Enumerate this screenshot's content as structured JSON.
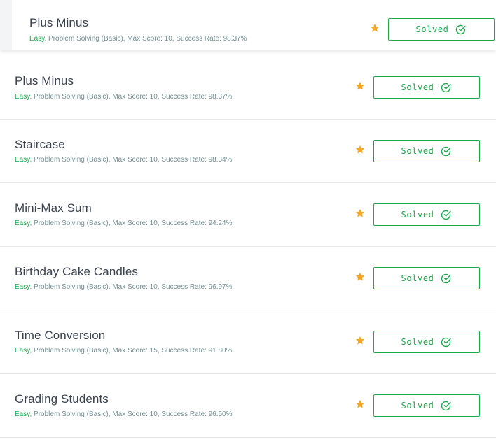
{
  "challenges": [
    {
      "title": "Plus Minus",
      "difficulty": "Easy",
      "details": ", Problem Solving (Basic), Max Score: 10, Success Rate: 98.37%",
      "button_label": "Solved",
      "star_icon": "star-icon",
      "check_icon": "check-circle-icon"
    },
    {
      "title": "Plus Minus",
      "difficulty": "Easy",
      "details": ", Problem Solving (Basic), Max Score: 10, Success Rate: 98.37%",
      "button_label": "Solved",
      "star_icon": "star-icon",
      "check_icon": "check-circle-icon"
    },
    {
      "title": "Staircase",
      "difficulty": "Easy",
      "details": ", Problem Solving (Basic), Max Score: 10, Success Rate: 98.34%",
      "button_label": "Solved",
      "star_icon": "star-icon",
      "check_icon": "check-circle-icon"
    },
    {
      "title": "Mini-Max Sum",
      "difficulty": "Easy",
      "details": ", Problem Solving (Basic), Max Score: 10, Success Rate: 94.24%",
      "button_label": "Solved",
      "star_icon": "star-icon",
      "check_icon": "check-circle-icon"
    },
    {
      "title": "Birthday Cake Candles",
      "difficulty": "Easy",
      "details": ", Problem Solving (Basic), Max Score: 10, Success Rate: 96.97%",
      "button_label": "Solved",
      "star_icon": "star-icon",
      "check_icon": "check-circle-icon"
    },
    {
      "title": "Time Conversion",
      "difficulty": "Easy",
      "details": ", Problem Solving (Basic), Max Score: 15, Success Rate: 91.80%",
      "button_label": "Solved",
      "star_icon": "star-icon",
      "check_icon": "check-circle-icon"
    },
    {
      "title": "Grading Students",
      "difficulty": "Easy",
      "details": ", Problem Solving (Basic), Max Score: 10, Success Rate: 96.50%",
      "button_label": "Solved",
      "star_icon": "star-icon",
      "check_icon": "check-circle-icon"
    }
  ],
  "colors": {
    "accent_green": "#1ba94c",
    "star_orange": "#f5a623",
    "title_text": "#39424e",
    "meta_text": "#738f93"
  }
}
